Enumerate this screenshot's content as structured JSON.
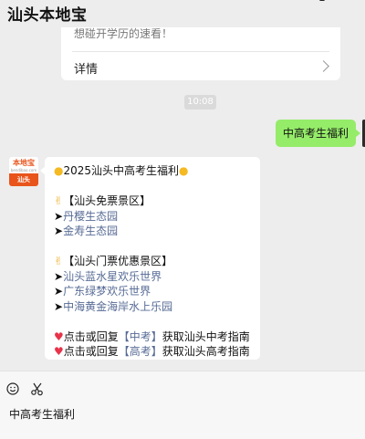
{
  "header": {
    "title": "汕头本地宝"
  },
  "previous_card": {
    "cut_text": "想碰开学历的速看！",
    "detail_label": "详情"
  },
  "timestamp": "10:08",
  "outgoing_message": {
    "text": "中高考生福利"
  },
  "bot": {
    "avatar_top": "本地宝",
    "avatar_url": "bendibao.com",
    "avatar_bottom": "汕头"
  },
  "incoming_message": {
    "title": "2025汕头中高考生福利",
    "free_section": "【汕头免票景区】",
    "free_items": [
      "丹樱生态园",
      "金寿生态园"
    ],
    "discount_section": "【汕头门票优惠景区】",
    "discount_items": [
      "汕头蓝水星欢乐世界",
      "广东绿梦欢乐世界",
      "中海黄金海岸水上乐园"
    ],
    "reply_prefix": "点击或回复",
    "zhongkao_keyword": "【中考】",
    "zhongkao_suffix": "获取汕头中考指南",
    "gaokao_keyword": "【高考】",
    "gaokao_suffix": "获取汕头高考指南"
  },
  "input": {
    "text": "中高考生福利"
  },
  "colors": {
    "background": "#ededed",
    "outgoing_bubble": "#95ec69",
    "link": "#576b95",
    "brand_orange": "#e8541b"
  },
  "icons": [
    "chevron-right-icon",
    "sun-icon",
    "victory-hand-icon",
    "arrow-right-icon",
    "heart-icon",
    "emoji-icon",
    "scissors-icon"
  ]
}
